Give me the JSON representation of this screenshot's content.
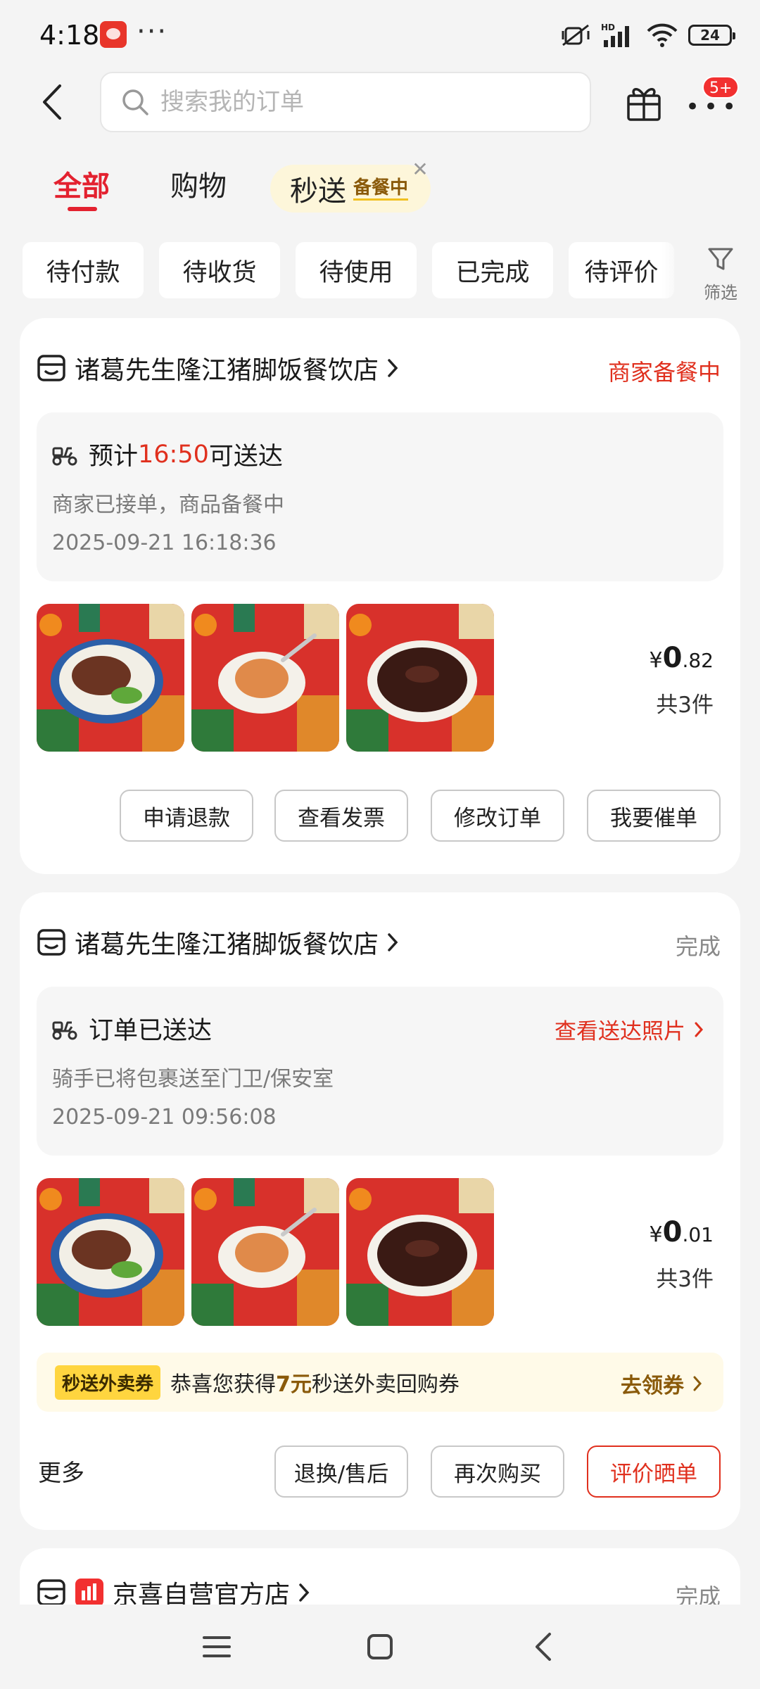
{
  "status_bar": {
    "time": "4:18",
    "dots": "···",
    "battery": "24",
    "network_label": "HD"
  },
  "header": {
    "search_placeholder": "搜索我的订单",
    "more_badge": "5+"
  },
  "tabs": {
    "all": "全部",
    "shopping": "购物",
    "flash": "秒送",
    "flash_badge": "备餐中"
  },
  "filters": {
    "items": [
      "待付款",
      "待收货",
      "待使用",
      "已完成",
      "待评价"
    ],
    "filter_label": "筛选"
  },
  "orders": [
    {
      "shop": "诸葛先生隆江猪脚饭餐饮店",
      "status": "商家备餐中",
      "eta_prefix": "预计",
      "eta_time": "16:50",
      "eta_suffix": "可送达",
      "desc": "商家已接单，商品备餐中",
      "timestamp": "2025-09-21 16:18:36",
      "price_yen": "¥",
      "price_int": "0",
      "price_dec": ".82",
      "quantity": "共3件",
      "actions": [
        "申请退款",
        "查看发票",
        "修改订单",
        "我要催单"
      ]
    },
    {
      "shop": "诸葛先生隆江猪脚饭餐饮店",
      "status": "完成",
      "title": "订单已送达",
      "link": "查看送达照片",
      "desc": "骑手已将包裹送至门卫/保安室",
      "timestamp": "2025-09-21 09:56:08",
      "price_yen": "¥",
      "price_int": "0",
      "price_dec": ".01",
      "quantity": "共3件",
      "coupon_tag": "秒送外卖券",
      "coupon_text_pre": "恭喜您获得",
      "coupon_amount": "7元",
      "coupon_text_post": "秒送外卖回购券",
      "coupon_link": "去领券",
      "more": "更多",
      "actions": [
        "退换/售后",
        "再次购买",
        "评价晒单"
      ]
    },
    {
      "shop": "京喜自营官方店",
      "status": "完成"
    }
  ],
  "colors": {
    "accent_red": "#e3212f",
    "status_red": "#e0301e",
    "coupon_bg": "#fffae8",
    "pill_bg": "#fdf6da"
  }
}
